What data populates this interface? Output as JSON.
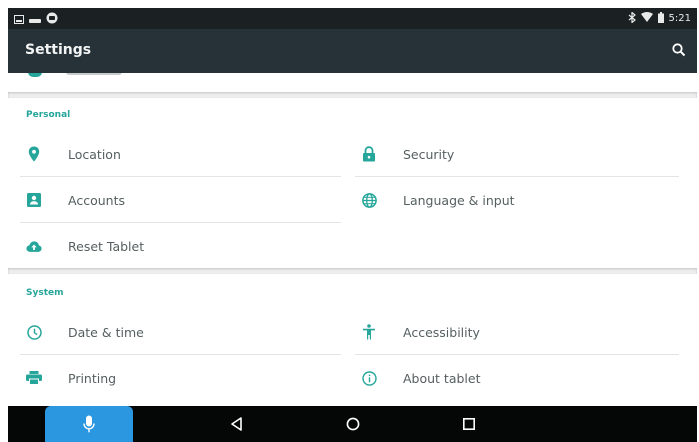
{
  "status_bar": {
    "time": "5:21",
    "left_icons": [
      "screenshot-icon",
      "notification-icon",
      "android-icon"
    ],
    "right_icons": [
      "bluetooth-icon",
      "wifi-icon",
      "battery-icon"
    ]
  },
  "app_bar": {
    "title": "Settings",
    "action_icon": "search-icon"
  },
  "sections": [
    {
      "header": "Personal",
      "items": [
        {
          "label": "Location",
          "icon": "location-pin-icon"
        },
        {
          "label": "Security",
          "icon": "lock-icon"
        },
        {
          "label": "Accounts",
          "icon": "account-box-icon"
        },
        {
          "label": "Language & input",
          "icon": "globe-icon"
        },
        {
          "label": "Reset Tablet",
          "icon": "cloud-upload-icon"
        }
      ]
    },
    {
      "header": "System",
      "items": [
        {
          "label": "Date & time",
          "icon": "clock-icon"
        },
        {
          "label": "Accessibility",
          "icon": "accessibility-icon"
        },
        {
          "label": "Printing",
          "icon": "printer-icon"
        },
        {
          "label": "About tablet",
          "icon": "info-icon"
        }
      ]
    }
  ],
  "nav_bar": {
    "buttons": [
      "mic-icon",
      "back-icon",
      "home-icon",
      "recents-icon"
    ]
  },
  "colors": {
    "accent": "#26a69a",
    "app_bar": "#263238",
    "status_bar": "#1b2122",
    "nav_bar": "#050707",
    "voice_tab": "#2a97e0"
  }
}
